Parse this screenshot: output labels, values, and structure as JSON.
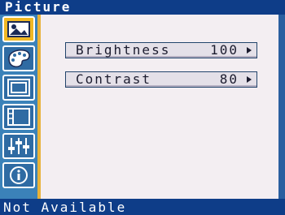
{
  "window": {
    "title": "Picture"
  },
  "sidebar": {
    "items": [
      {
        "icon": "picture-icon",
        "selected": true
      },
      {
        "icon": "palette-icon",
        "selected": false
      },
      {
        "icon": "screen-position-icon",
        "selected": false
      },
      {
        "icon": "image-setup-icon",
        "selected": false
      },
      {
        "icon": "sliders-icon",
        "selected": false
      },
      {
        "icon": "info-icon",
        "selected": false
      }
    ]
  },
  "menu": {
    "rows": [
      {
        "label": "Brightness",
        "value": "100"
      },
      {
        "label": "Contrast",
        "value": "80"
      }
    ]
  },
  "status": {
    "text": "Not Available"
  },
  "colors": {
    "title_bar": "#0e3d88",
    "sidebar": "#3b82b9",
    "selected_icon": "#f0b824",
    "panel": "#f3eef2"
  }
}
